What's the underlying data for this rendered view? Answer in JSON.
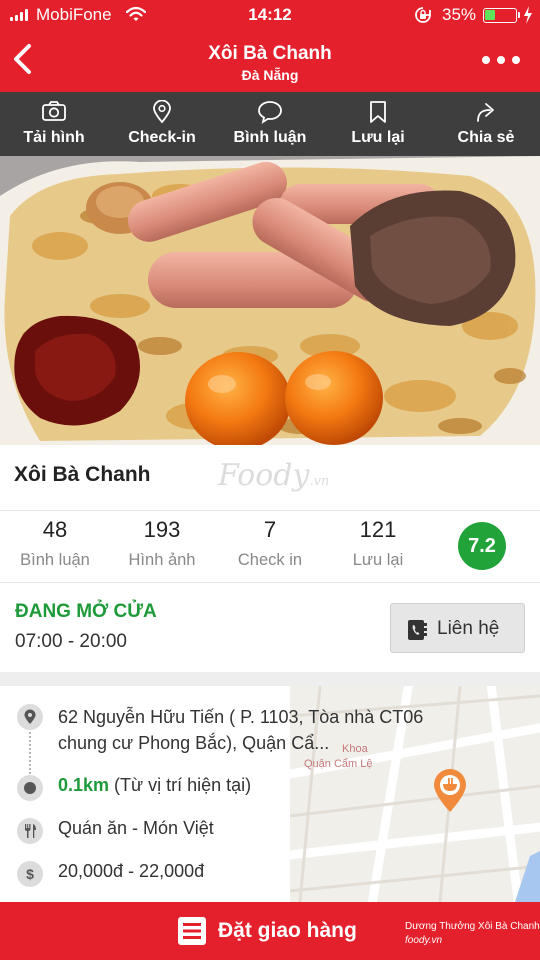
{
  "status_bar": {
    "carrier": "MobiFone",
    "time": "14:12",
    "battery": "35%",
    "battery_level": 0.35,
    "icons": [
      "signal-icon",
      "wifi-icon",
      "rotation-lock-icon",
      "battery-icon",
      "charging-icon"
    ]
  },
  "header": {
    "title": "Xôi Bà Chanh",
    "subtitle": "Đà Nẵng",
    "icons": [
      "back-icon",
      "more-icon"
    ]
  },
  "actions": [
    {
      "label": "Tải hình",
      "icon": "camera-icon"
    },
    {
      "label": "Check-in",
      "icon": "location-pin-icon"
    },
    {
      "label": "Bình luận",
      "icon": "comment-icon"
    },
    {
      "label": "Lưu lại",
      "icon": "bookmark-icon"
    },
    {
      "label": "Chia sẻ",
      "icon": "share-icon"
    }
  ],
  "restaurant": {
    "name": "Xôi Bà Chanh",
    "watermark": "Foody",
    "watermark_suffix": ".vn"
  },
  "stats": [
    {
      "value": "48",
      "label": "Bình luận"
    },
    {
      "value": "193",
      "label": "Hình ảnh"
    },
    {
      "value": "7",
      "label": "Check in"
    },
    {
      "value": "121",
      "label": "Lưu lại"
    }
  ],
  "rating": "7.2",
  "open_status": "ĐANG MỞ CỬA",
  "hours": "07:00 - 20:00",
  "contact_button": "Liên hệ",
  "info": {
    "address": "62 Nguyễn Hữu Tiến ( P. 1103, Tòa nhà CT06 chung cư Phong Bắc), Quận Cẩ...",
    "distance": "0.1km",
    "distance_note": " (Từ vị trí hiện tại)",
    "category": "Quán ăn - Món Việt",
    "price": "20,000đ - 22,000đ"
  },
  "map": {
    "label_1": "Khoa",
    "label_2": "Quận Cẩm Lệ",
    "icon": "restaurant-marker-icon"
  },
  "bottom_bar": {
    "order_label": "Đặt giao hàng",
    "credit": "Dương Thưởng Xôi Bà Chanh",
    "credit_logo": "foody.vn"
  },
  "colors": {
    "brand_red": "#e3202b",
    "action_bar": "#3e3e3e",
    "open_green": "#1f9a3a",
    "rating_green": "#22a33a"
  }
}
